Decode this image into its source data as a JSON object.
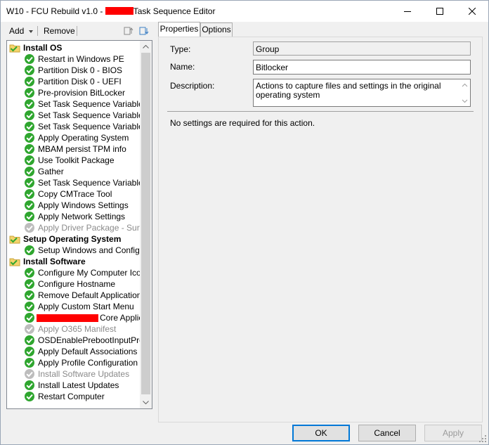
{
  "window": {
    "title_prefix": "W10 - FCU Rebuild v1.0 - ",
    "title_suffix": "Task Sequence Editor"
  },
  "toolbar": {
    "add_label": "Add",
    "remove_label": "Remove"
  },
  "tree": {
    "items": [
      {
        "label": "Install OS",
        "type": "group",
        "indent": 0
      },
      {
        "label": "Restart in Windows PE",
        "type": "step",
        "indent": 1
      },
      {
        "label": "Partition Disk 0 - BIOS",
        "type": "step",
        "indent": 1
      },
      {
        "label": "Partition Disk 0 - UEFI",
        "type": "step",
        "indent": 1
      },
      {
        "label": "Pre-provision BitLocker",
        "type": "step",
        "indent": 1
      },
      {
        "label": "Set Task Sequence Variable",
        "type": "step",
        "indent": 1
      },
      {
        "label": "Set Task Sequence Variable",
        "type": "step",
        "indent": 1
      },
      {
        "label": "Set Task Sequence Variable",
        "type": "step",
        "indent": 1
      },
      {
        "label": "Apply Operating System",
        "type": "step",
        "indent": 1
      },
      {
        "label": "MBAM persist TPM info",
        "type": "step",
        "indent": 1
      },
      {
        "label": "Use Toolkit Package",
        "type": "step",
        "indent": 1
      },
      {
        "label": "Gather",
        "type": "step",
        "indent": 1
      },
      {
        "label": "Set Task Sequence Variable",
        "type": "step",
        "indent": 1
      },
      {
        "label": "Copy CMTrace Tool",
        "type": "step",
        "indent": 1
      },
      {
        "label": "Apply Windows Settings",
        "type": "step",
        "indent": 1
      },
      {
        "label": "Apply Network Settings",
        "type": "step",
        "indent": 1
      },
      {
        "label": "Apply Driver Package - Surface",
        "type": "disabled",
        "indent": 1
      },
      {
        "label": "Setup Operating System",
        "type": "group",
        "indent": 0
      },
      {
        "label": "Setup Windows and ConfigMgr",
        "type": "step",
        "indent": 1
      },
      {
        "label": "Install Software",
        "type": "group",
        "indent": 0
      },
      {
        "label": "Configure My Computer Icon",
        "type": "step",
        "indent": 1
      },
      {
        "label": "Configure Hostname",
        "type": "step",
        "indent": 1
      },
      {
        "label": "Remove Default Applications",
        "type": "step",
        "indent": 1
      },
      {
        "label": "Apply Custom Start Menu",
        "type": "step",
        "indent": 1
      },
      {
        "label": "Core Applications",
        "type": "step",
        "indent": 1,
        "redacted_prefix": true
      },
      {
        "label": "Apply O365 Manifest",
        "type": "disabled",
        "indent": 1
      },
      {
        "label": "OSDEnablePrebootInputProtectors",
        "type": "step",
        "indent": 1
      },
      {
        "label": "Apply Default Associations",
        "type": "step",
        "indent": 1
      },
      {
        "label": "Apply Profile Configuration",
        "type": "step",
        "indent": 1
      },
      {
        "label": "Install Software Updates",
        "type": "disabled",
        "indent": 1
      },
      {
        "label": "Install Latest Updates",
        "type": "step",
        "indent": 1
      },
      {
        "label": "Restart Computer",
        "type": "step",
        "indent": 1
      }
    ]
  },
  "tabs": [
    {
      "label": "Properties",
      "active": true
    },
    {
      "label": "Options",
      "active": false
    }
  ],
  "properties": {
    "type_label": "Type:",
    "type_value": "Group",
    "name_label": "Name:",
    "name_value": "Bitlocker",
    "description_label": "Description:",
    "description_value": "Actions to capture files and settings in the original operating system",
    "no_settings_text": "No settings are required  for this action."
  },
  "buttons": {
    "ok": "OK",
    "cancel": "Cancel",
    "apply": "Apply"
  },
  "colors": {
    "check_green": "#2fa62f",
    "disabled_gray": "#bdbdbd",
    "folder_yellow": "#f4d36c",
    "accent_blue": "#0078d7",
    "redaction": "#ff0000"
  }
}
